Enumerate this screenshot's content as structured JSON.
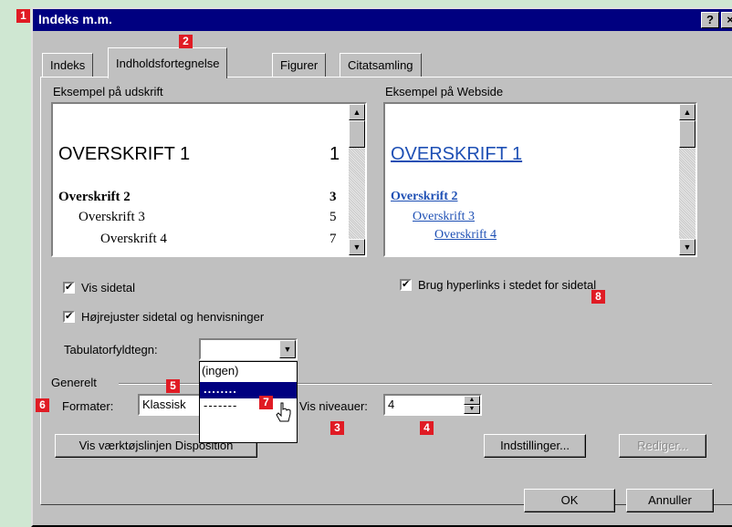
{
  "dialog": {
    "title": "Indeks m.m.",
    "help_button": "?",
    "close_button": "×"
  },
  "tabs": [
    {
      "label": "Indeks",
      "active": false
    },
    {
      "label": "Indholdsfortegnelse",
      "active": true
    },
    {
      "label": "Figurer",
      "active": false
    },
    {
      "label": "Citatsamling",
      "active": false
    }
  ],
  "print_preview": {
    "label": "Eksempel på udskrift",
    "entries": [
      {
        "text": "OVERSKRIFT 1",
        "page": "1"
      },
      {
        "text": "Overskrift 2",
        "page": "3"
      },
      {
        "text": "Overskrift 3",
        "page": "5"
      },
      {
        "text": "Overskrift 4",
        "page": "7"
      }
    ]
  },
  "web_preview": {
    "label": "Eksempel på Webside",
    "entries": [
      "OVERSKRIFT 1",
      "Overskrift 2",
      "Overskrift 3",
      "Overskrift 4"
    ]
  },
  "options": {
    "show_page_numbers": {
      "label": "Vis sidetal",
      "checked": true
    },
    "right_align": {
      "label": "Højrejuster sidetal og henvisninger",
      "checked": true
    },
    "hyperlinks": {
      "label": "Brug hyperlinks i stedet for sidetal",
      "checked": true
    },
    "check_glyph": "✔"
  },
  "tab_leader": {
    "label": "Tabulatorfyldtegn:",
    "value": "",
    "options": [
      "(ingen)",
      "........",
      "-------"
    ]
  },
  "general": {
    "label": "Generelt",
    "formats_label": "Formater:",
    "formats_value": "Klassisk",
    "levels_label": "Vis niveauer:",
    "levels_value": "4"
  },
  "buttons": {
    "outline_toolbar": "Vis værktøjslinjen Disposition",
    "settings": "Indstillinger...",
    "edit": "Rediger...",
    "ok": "OK",
    "cancel": "Annuller"
  },
  "markers": [
    "1",
    "2",
    "3",
    "4",
    "5",
    "6",
    "7",
    "8"
  ]
}
